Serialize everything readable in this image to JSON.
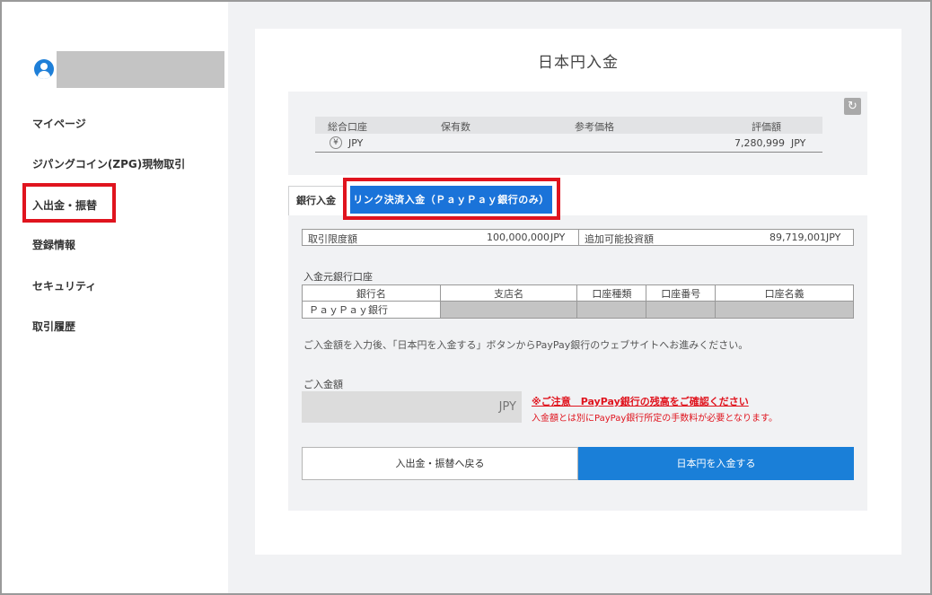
{
  "sidebar": {
    "items": [
      {
        "label": "マイページ"
      },
      {
        "label": "ジパングコイン(ZPG)現物取引"
      },
      {
        "label": "入出金・振替"
      },
      {
        "label": "登録情報"
      },
      {
        "label": "セキュリティ"
      },
      {
        "label": "取引履歴"
      }
    ],
    "highlighted_item": "入出金・振替"
  },
  "page": {
    "title": "日本円入金"
  },
  "summary": {
    "headers": [
      "総合口座",
      "保有数",
      "参考価格",
      "評価額"
    ],
    "row": {
      "currency": "JPY",
      "value": "7,280,999",
      "unit": "JPY",
      "currency_icon": "yen-icon"
    }
  },
  "tabs": {
    "bank": "銀行入金",
    "link": "リンク決済入金（ＰａｙＰａｙ銀行のみ）"
  },
  "limits": {
    "trade_limit_label": "取引限度額",
    "trade_limit_value": "100,000,000",
    "trade_limit_unit": "JPY",
    "add_invest_label": "追加可能投資額",
    "add_invest_value": "89,719,001",
    "add_invest_unit": "JPY"
  },
  "source_account": {
    "section_label": "入金元銀行口座",
    "headers": [
      "銀行名",
      "支店名",
      "口座種類",
      "口座番号",
      "口座名義"
    ],
    "bank_name": "ＰａｙＰａｙ銀行"
  },
  "notice": "ご入金額を入力後、「日本円を入金する」ボタンからPayPay銀行のウェブサイトへお進みください。",
  "amount": {
    "label": "ご入金額",
    "unit": "JPY",
    "warning_title": "※ご注意　PayPay銀行の残高をご確認ください",
    "warning_text": "入金額とは別にPayPay銀行所定の手数料が必要となります。"
  },
  "buttons": {
    "back": "入出金・振替へ戻る",
    "deposit": "日本円を入金する"
  },
  "colors": {
    "accent": "#1a73d9",
    "highlight": "#e0141e",
    "panel_bg": "#f1f2f4"
  }
}
